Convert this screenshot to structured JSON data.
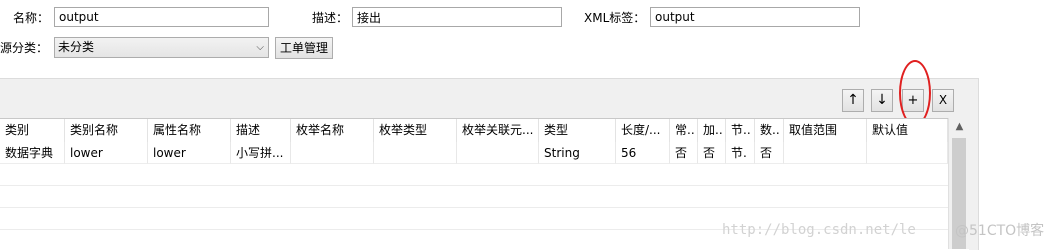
{
  "form": {
    "name_label": "名称：",
    "name_value": "output",
    "desc_label": "描述：",
    "desc_value": "接出",
    "xml_label": "XML标签：",
    "xml_value": "output",
    "category_label": "源分类：",
    "category_value": "未分类",
    "manage_button": "工单管理"
  },
  "toolbar": {
    "up": "↑",
    "down": "↓",
    "add": "+",
    "remove": "X"
  },
  "table": {
    "columns": [
      "类别",
      "类别名称",
      "属性名称",
      "描述",
      "枚举名称",
      "枚举类型",
      "枚举关联元...",
      "类型",
      "长度/...",
      "常..",
      "加..",
      "节..",
      "数..",
      "取值范围",
      "默认值"
    ],
    "rows": [
      [
        "数据字典",
        "lower",
        "lower",
        "小写拼...",
        "",
        "",
        "",
        "String",
        "56",
        "否",
        "否",
        "节.",
        "否",
        "",
        ""
      ]
    ]
  },
  "watermark": {
    "url": "http://blog.csdn.net/le",
    "brand": "@51CTO博客"
  },
  "colors": {
    "highlight_circle": "#e02020"
  }
}
